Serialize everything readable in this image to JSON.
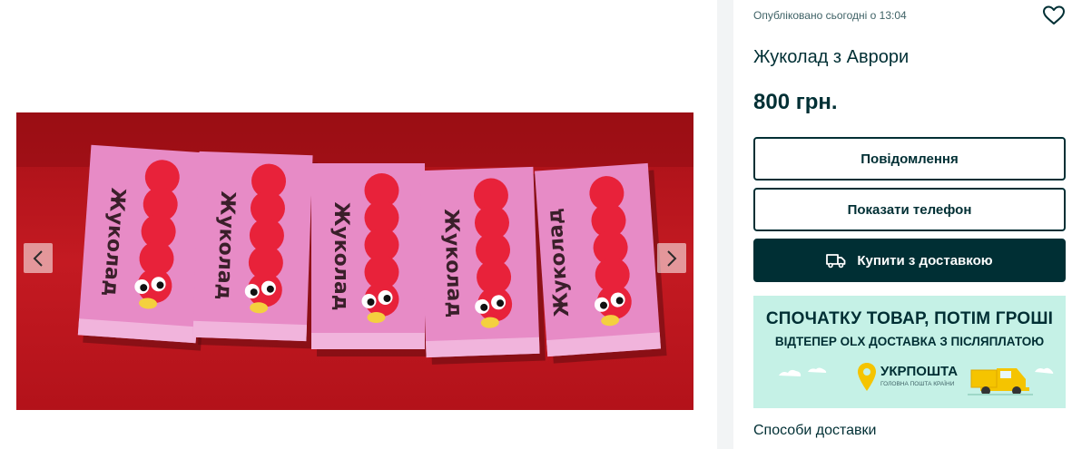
{
  "gallery": {
    "image_subject": "Жуколад"
  },
  "ad": {
    "posted": "Опубліковано сьогодні о 13:04",
    "title": "Жуколад з Аврори",
    "price": "800 грн."
  },
  "actions": {
    "message_label": "Повідомлення",
    "phone_label": "Показати телефон",
    "buy_label": "Купити з доставкою"
  },
  "promo": {
    "headline": "СПОЧАТКУ ТОВАР, ПОТІМ ГРОШІ",
    "subline": "ВІДТЕПЕР OLX ДОСТАВКА З ПІСЛЯПЛАТОЮ",
    "brand": "УКРПОШТА",
    "brand_tagline": "ГОЛОВНА ПОШТА КРАЇНИ"
  },
  "delivery": {
    "heading": "Способи доставки"
  },
  "colors": {
    "primary": "#002f34",
    "promo_bg": "#c5f1e6",
    "box_pink": "#e78bc6",
    "photo_bg": "#b5141d",
    "ukrposhta_yellow": "#f5c400"
  }
}
